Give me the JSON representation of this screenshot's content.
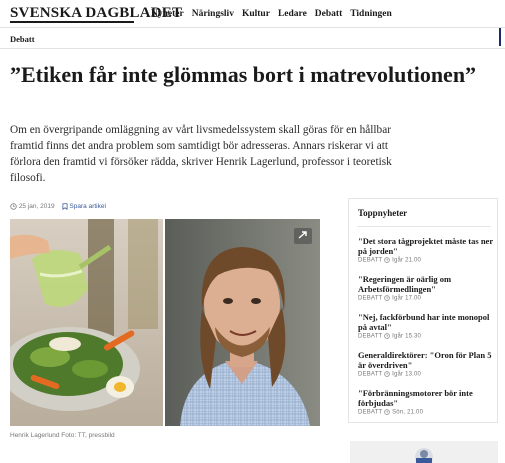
{
  "header": {
    "logo": "SVENSKA DAGBLADET",
    "nav": [
      "Nyheter",
      "Näringsliv",
      "Kultur",
      "Ledare",
      "Debatt",
      "Tidningen"
    ],
    "section": "Debatt"
  },
  "article": {
    "headline": "”Etiken får inte glömmas bort i matrevolutionen”",
    "lead": "Om en övergripande omläggning av vårt livsmedelssystem skall göras för en hållbar framtid finns det andra problem som samtidigt bör adresseras. Annars riskerar vi att förlora den framtid vi försöker rädda, skriver Henrik Lagerlund, professor i teoretisk filosofi.",
    "date": "25 jan, 2019",
    "save_label": "Spara artikel",
    "caption": "Henrik Lagerlund  Foto: TT, pressbild"
  },
  "sidebar": {
    "title": "Toppnyheter",
    "items": [
      {
        "title": "\"Det stora tågprojektet måste tas ner på jorden\"",
        "meta": "DEBATT",
        "time": "Igår 21.00"
      },
      {
        "title": "\"Regeringen är oärlig om Arbetsförmedlingen\"",
        "meta": "DEBATT",
        "time": "Igår 17.00"
      },
      {
        "title": "\"Nej, fackförbund har inte monopol på avtal\"",
        "meta": "DEBATT",
        "time": "Igår 15.30"
      },
      {
        "title": "Generaldirektörer: \"Oron för Plan 5 är överdriven\"",
        "meta": "DEBATT",
        "time": "Igår 13.00"
      },
      {
        "title": "\"Förbränningsmotorer bör inte förbjudas\"",
        "meta": "DEBATT",
        "time": "Sön, 21.00"
      }
    ]
  },
  "icons": [
    "clock-icon",
    "bookmark-icon",
    "expand-icon"
  ]
}
